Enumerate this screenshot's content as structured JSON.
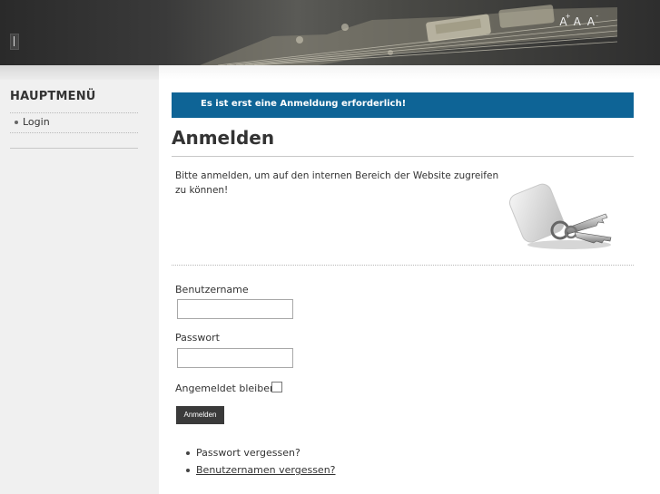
{
  "header": {
    "font_tools": [
      {
        "label": "A",
        "sup": "+",
        "name": "font-increase-button"
      },
      {
        "label": "A",
        "sup": "",
        "name": "font-reset-button"
      },
      {
        "label": "A",
        "sup": "-",
        "name": "font-decrease-button"
      }
    ]
  },
  "sidebar": {
    "title": "HAUPTMENÜ",
    "items": [
      {
        "label": "Login"
      }
    ]
  },
  "main": {
    "notice": "Es ist erst eine Anmeldung erforderlich!",
    "title": "Anmelden",
    "intro": "Bitte anmelden, um auf den internen Bereich der Website zugreifen zu können!",
    "form": {
      "username_label": "Benutzername",
      "username_value": "",
      "password_label": "Passwort",
      "password_value": "",
      "remember_label": "Angemeldet bleiben",
      "submit_label": "Anmelden"
    },
    "links": {
      "forgot_password": "Passwort vergessen?",
      "forgot_username": "Benutzernamen vergessen?"
    }
  },
  "colors": {
    "notice_bg": "#0e6496",
    "sidebar_bg": "#f0f0f0",
    "header_bg": "#3a3a3a"
  }
}
